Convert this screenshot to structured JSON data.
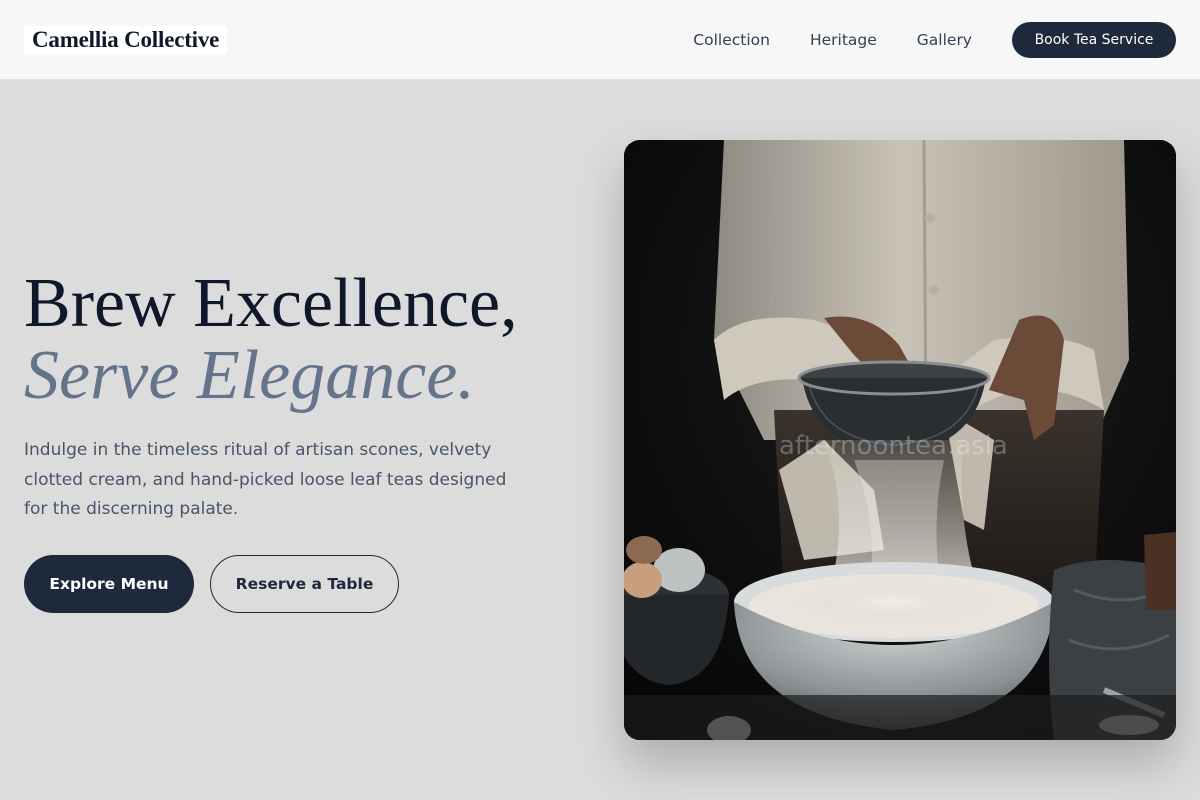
{
  "brand": {
    "name": "Camellia Collective"
  },
  "nav": {
    "links": [
      "Collection",
      "Heritage",
      "Gallery"
    ],
    "cta_label": "Book Tea Service"
  },
  "hero": {
    "headline_line1": "Brew Excellence,",
    "headline_line2": "Serve Elegance.",
    "description": "Indulge in the timeless ritual of artisan scones, velvety clotted cream, and hand-picked loose leaf teas designed for the discerning palate.",
    "primary_cta": "Explore Menu",
    "secondary_cta": "Reserve a Table"
  },
  "image": {
    "subject": "baker-sifting-flour-photo",
    "watermark": "afternoontea.asia"
  },
  "colors": {
    "page_background": "#dcdcdc",
    "navbar_background": "#f7f7f8",
    "primary_dark": "#1e293b",
    "headline": "#0f172a",
    "headline_accent": "#64748b",
    "body_text": "#475569"
  }
}
